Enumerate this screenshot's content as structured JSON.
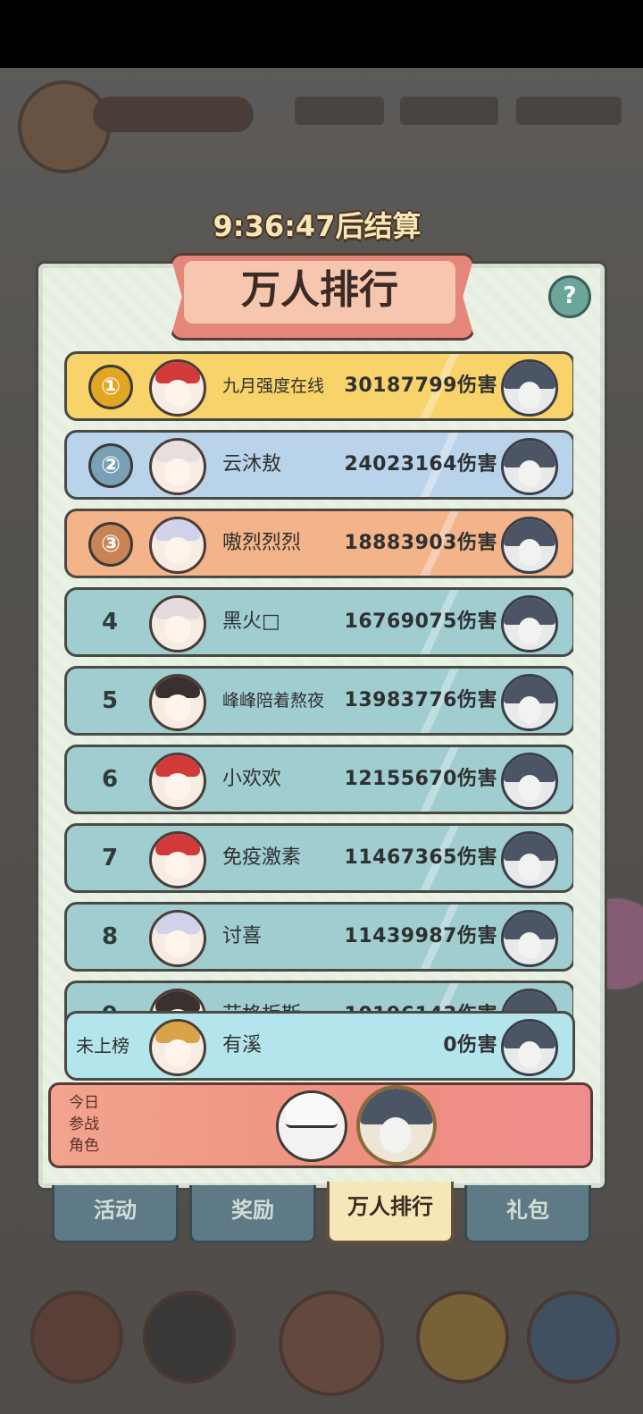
{
  "timer": "9:36:47后结算",
  "title": "万人排行",
  "help_icon": "question-icon",
  "rows": [
    {
      "rank": "1",
      "medal": "①",
      "name": "九月强度在线",
      "damage": "30187799伤害",
      "bg": "#f8d36a",
      "medal_color": "#e2a623",
      "hair": "#d23a3a",
      "small": true
    },
    {
      "rank": "2",
      "medal": "②",
      "name": "云沐敖",
      "damage": "24023164伤害",
      "bg": "#b9d3ea",
      "medal_color": "#7aa0b6",
      "hair": "#e7dede",
      "small": false
    },
    {
      "rank": "3",
      "medal": "③",
      "name": "嗷烈烈烈",
      "damage": "18883903伤害",
      "bg": "#f3b48a",
      "medal_color": "#c98456",
      "hair": "#cfd2e8",
      "small": false
    },
    {
      "rank": "4",
      "medal": "",
      "name": "黑火□",
      "damage": "16769075伤害",
      "bg": "#9fcdd0",
      "medal_color": "",
      "hair": "#e4dcdc",
      "small": false
    },
    {
      "rank": "5",
      "medal": "",
      "name": "峰峰陪着熬夜",
      "damage": "13983776伤害",
      "bg": "#9fcdd0",
      "medal_color": "",
      "hair": "#3a3030",
      "small": true
    },
    {
      "rank": "6",
      "medal": "",
      "name": "小欢欢",
      "damage": "12155670伤害",
      "bg": "#9fcdd0",
      "medal_color": "",
      "hair": "#d23a3a",
      "small": false
    },
    {
      "rank": "7",
      "medal": "",
      "name": "免疫激素",
      "damage": "11467365伤害",
      "bg": "#9fcdd0",
      "medal_color": "",
      "hair": "#d23a3a",
      "small": false
    },
    {
      "rank": "8",
      "medal": "",
      "name": "讨喜",
      "damage": "11439987伤害",
      "bg": "#9fcdd0",
      "medal_color": "",
      "hair": "#cfd2e8",
      "small": false
    },
    {
      "rank": "9",
      "medal": "",
      "name": "艾格板斯",
      "damage": "10196143伤害",
      "bg": "#9fcdd0",
      "medal_color": "",
      "hair": "#3a3030",
      "small": false
    }
  ],
  "me": {
    "rank_label": "未上榜",
    "name": "有溪",
    "damage": "0伤害"
  },
  "party_label": "今日参战角色",
  "party_icons": [
    "white-hair-character-icon",
    "dark-hair-character-icon"
  ],
  "tabs": [
    {
      "label": "活动",
      "active": false
    },
    {
      "label": "奖励",
      "active": false
    },
    {
      "label": "万人排行",
      "active": true
    },
    {
      "label": "礼包",
      "active": false
    }
  ]
}
